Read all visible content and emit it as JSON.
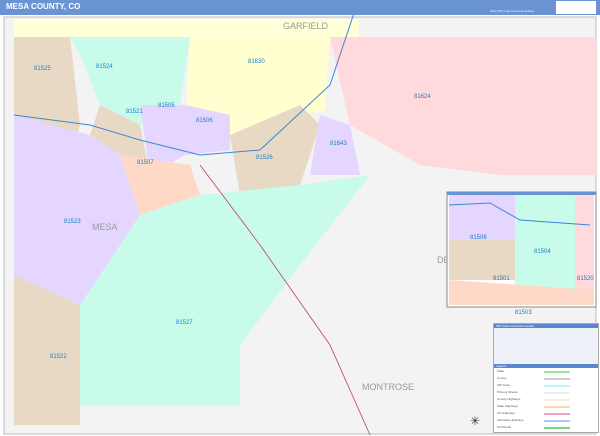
{
  "header": {
    "title": "MESA COUNTY, CO",
    "edition": "2022 ZIP Code ColorCast Edition"
  },
  "counties": [
    "GARFIELD",
    "MESA",
    "DELTA",
    "MONTROSE"
  ],
  "zips": [
    "81525",
    "81524",
    "81521",
    "81505",
    "81506",
    "81630",
    "81624",
    "81643",
    "81507",
    "81526",
    "81523",
    "81527",
    "81522"
  ],
  "inset": {
    "zips": [
      "81506",
      "81504",
      "81501",
      "81520",
      "81503"
    ]
  },
  "legend": {
    "index_title": "ZIP Code Index/Grid Locator",
    "legend_title": "Legend",
    "items": [
      "State",
      "County",
      "ZIP Code",
      "Primary Streets",
      "County Highways",
      "State Highways",
      "US Highways",
      "Interstate Highways",
      "Toll Roads"
    ]
  },
  "colors": {
    "header": "#6a93d4",
    "accent": "#1a7fc8"
  }
}
